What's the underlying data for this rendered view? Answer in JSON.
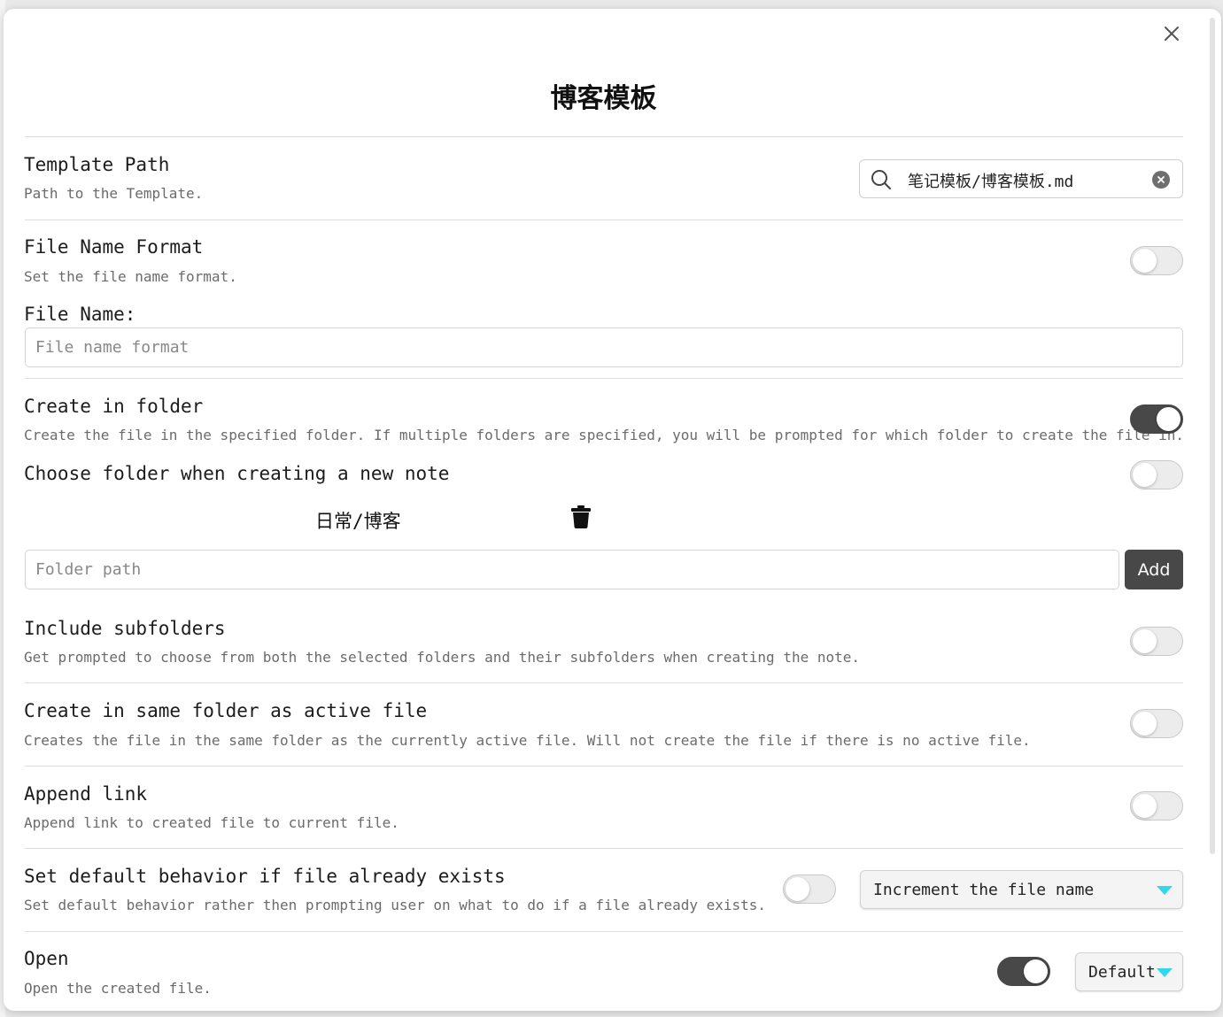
{
  "modal": {
    "title": "博客模板"
  },
  "template_path": {
    "name": "Template Path",
    "desc": "Path to the Template.",
    "value": "笔记模板/博客模板.md"
  },
  "file_name_format": {
    "name": "File Name Format",
    "desc": "Set the file name format.",
    "enabled": false,
    "field_label": "File Name:",
    "placeholder": "File name format",
    "value": ""
  },
  "create_in_folder": {
    "name": "Create in folder",
    "desc": "Create the file in the specified folder. If multiple folders are specified, you will be prompted for which folder to create the file in.",
    "enabled": true
  },
  "choose_folder": {
    "name": "Choose folder when creating a new note",
    "enabled": false,
    "folders": [
      "日常/博客"
    ],
    "placeholder": "Folder path",
    "add_label": "Add"
  },
  "include_subfolders": {
    "name": "Include subfolders",
    "desc": "Get prompted to choose from both the selected folders and their subfolders when creating the note.",
    "enabled": false
  },
  "same_folder": {
    "name": "Create in same folder as active file",
    "desc": "Creates the file in the same folder as the currently active file. Will not create the file if there is no active file.",
    "enabled": false
  },
  "append_link": {
    "name": "Append link",
    "desc": "Append link to created file to current file.",
    "enabled": false
  },
  "default_behavior": {
    "name": "Set default behavior if file already exists",
    "desc": "Set default behavior rather then prompting user on what to do if a file already exists.",
    "enabled": false,
    "selected": "Increment the file name"
  },
  "open": {
    "name": "Open",
    "desc": "Open the created file.",
    "enabled": true,
    "selected": "Default"
  },
  "colors": {
    "toggle_on": "#484848",
    "toggle_off": "#ececec",
    "dropdown_caret": "#33d6ea",
    "button": "#484848"
  }
}
